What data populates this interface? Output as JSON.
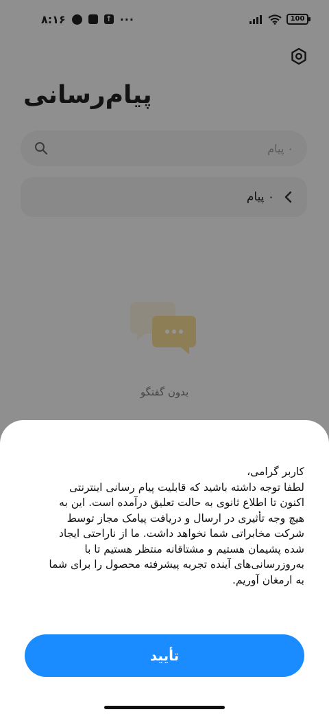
{
  "status_bar": {
    "time": "۸:۱۶",
    "more": "···",
    "battery": "100"
  },
  "header": {
    "title": "پیام‌رسانی",
    "settings_icon": "hexagon-gear-icon"
  },
  "search": {
    "placeholder": "۰ پیام",
    "icon": "search-icon"
  },
  "messages_row": {
    "label": "۰ پیام",
    "icon": "chevron-left-icon"
  },
  "empty_state": {
    "icon": "chat-bubbles-icon",
    "text": "بدون گفتگو"
  },
  "dialog": {
    "lines": [
      "کاربر گرامی،",
      "لطفا توجه داشته باشید که قابلیت پیام رسانی اینترنتی",
      "اکنون تا اطلاع ثانوی به حالت تعلیق درآمده است. این به",
      "هیچ وجه تأثیری در ارسال و دریافت پیامک مجاز توسط",
      "شرکت مخابراتی شما نخواهد داشت. ما از ناراحتی ایجاد",
      "شده پشیمان هستیم و مشتاقانه منتظر هستیم تا با",
      "به‌روزرسانی‌های آینده تجربه پیشرفته محصول را برای شما",
      "به ارمغان آوریم."
    ],
    "confirm_label": "تأیید"
  },
  "colors": {
    "accent": "#1a8cff",
    "background": "#f7f7f7",
    "card": "#ececec"
  }
}
